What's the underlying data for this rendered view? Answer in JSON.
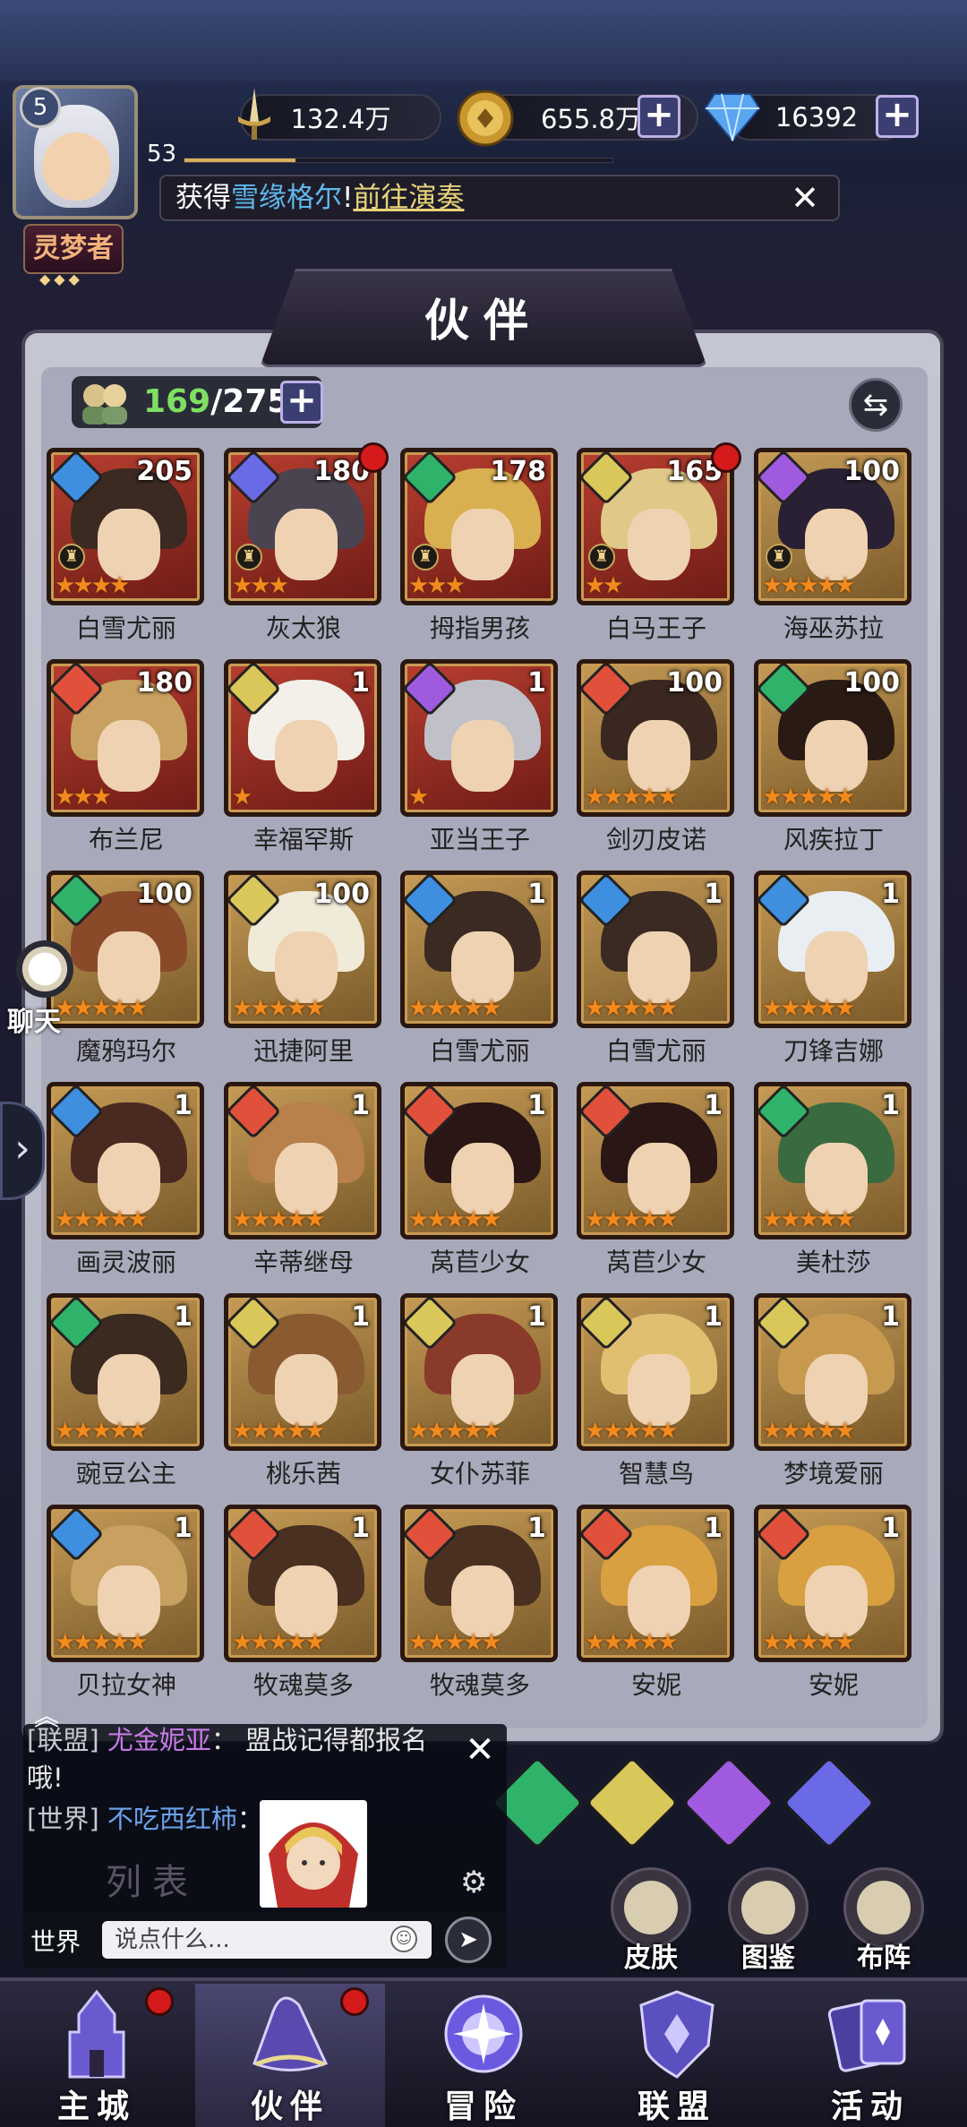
{
  "player": {
    "vip_level": "5",
    "level": "53",
    "xp_progress": 0.26,
    "rank": "灵梦者"
  },
  "resources": {
    "power": "132.4万",
    "gold": "655.8万",
    "diamonds": "16392"
  },
  "notice": {
    "prefix": "获得",
    "item": "雪缘格尔",
    "sep": "!",
    "link": "前往演奏"
  },
  "page_title": "伙伴",
  "roster_count": {
    "current": "169",
    "max": "/275"
  },
  "heroes": [
    {
      "name": "白雪尤丽",
      "level": "205",
      "element": "water",
      "stars": 4,
      "frame": "red",
      "badge": true,
      "red_dot": false
    },
    {
      "name": "灰太狼",
      "level": "180",
      "element": "void",
      "stars": 3,
      "frame": "red",
      "badge": true,
      "red_dot": true
    },
    {
      "name": "拇指男孩",
      "level": "178",
      "element": "wind",
      "stars": 3,
      "frame": "red",
      "badge": true,
      "red_dot": false
    },
    {
      "name": "白马王子",
      "level": "165",
      "element": "light",
      "stars": 2,
      "frame": "red",
      "badge": true,
      "red_dot": true
    },
    {
      "name": "海巫苏拉",
      "level": "100",
      "element": "dark",
      "stars": 5,
      "frame": "gold",
      "badge": true,
      "red_dot": false
    },
    {
      "name": "布兰尼",
      "level": "180",
      "element": "fire",
      "stars": 3,
      "frame": "red",
      "badge": false,
      "red_dot": false
    },
    {
      "name": "幸福罕斯",
      "level": "1",
      "element": "light",
      "stars": 1,
      "frame": "red",
      "badge": false,
      "red_dot": false
    },
    {
      "name": "亚当王子",
      "level": "1",
      "element": "dark",
      "stars": 1,
      "frame": "red",
      "badge": false,
      "red_dot": false
    },
    {
      "name": "剑刃皮诺",
      "level": "100",
      "element": "fire",
      "stars": 5,
      "frame": "gold",
      "badge": false,
      "red_dot": false
    },
    {
      "name": "风疾拉丁",
      "level": "100",
      "element": "wind",
      "stars": 5,
      "frame": "gold",
      "badge": false,
      "red_dot": false
    },
    {
      "name": "魔鸦玛尔",
      "level": "100",
      "element": "wind",
      "stars": 5,
      "frame": "gold",
      "badge": false,
      "red_dot": false
    },
    {
      "name": "迅捷阿里",
      "level": "100",
      "element": "light",
      "stars": 5,
      "frame": "gold",
      "badge": false,
      "red_dot": false
    },
    {
      "name": "白雪尤丽",
      "level": "1",
      "element": "water",
      "stars": 5,
      "frame": "gold",
      "badge": false,
      "red_dot": false
    },
    {
      "name": "白雪尤丽",
      "level": "1",
      "element": "water",
      "stars": 5,
      "frame": "gold",
      "badge": false,
      "red_dot": false
    },
    {
      "name": "刀锋吉娜",
      "level": "1",
      "element": "water",
      "stars": 5,
      "frame": "gold",
      "badge": false,
      "red_dot": false
    },
    {
      "name": "画灵波丽",
      "level": "1",
      "element": "water",
      "stars": 5,
      "frame": "gold",
      "badge": false,
      "red_dot": false
    },
    {
      "name": "辛蒂继母",
      "level": "1",
      "element": "fire",
      "stars": 5,
      "frame": "gold",
      "badge": false,
      "red_dot": false
    },
    {
      "name": "莴苣少女",
      "level": "1",
      "element": "fire",
      "stars": 5,
      "frame": "gold",
      "badge": false,
      "red_dot": false
    },
    {
      "name": "莴苣少女",
      "level": "1",
      "element": "fire",
      "stars": 5,
      "frame": "gold",
      "badge": false,
      "red_dot": false
    },
    {
      "name": "美杜莎",
      "level": "1",
      "element": "wind",
      "stars": 5,
      "frame": "gold",
      "badge": false,
      "red_dot": false
    },
    {
      "name": "豌豆公主",
      "level": "1",
      "element": "wind",
      "stars": 5,
      "frame": "gold",
      "badge": false,
      "red_dot": false
    },
    {
      "name": "桃乐茜",
      "level": "1",
      "element": "light",
      "stars": 5,
      "frame": "gold",
      "badge": false,
      "red_dot": false
    },
    {
      "name": "女仆苏菲",
      "level": "1",
      "element": "light",
      "stars": 5,
      "frame": "gold",
      "badge": false,
      "red_dot": false
    },
    {
      "name": "智慧鸟",
      "level": "1",
      "element": "light",
      "stars": 5,
      "frame": "gold",
      "badge": false,
      "red_dot": false
    },
    {
      "name": "梦境爱丽",
      "level": "1",
      "element": "light",
      "stars": 5,
      "frame": "gold",
      "badge": false,
      "red_dot": false
    },
    {
      "name": "贝拉女神",
      "level": "1",
      "element": "water",
      "stars": 5,
      "frame": "gold",
      "badge": false,
      "red_dot": false
    },
    {
      "name": "牧魂莫多",
      "level": "1",
      "element": "fire",
      "stars": 5,
      "frame": "gold",
      "badge": false,
      "red_dot": false
    },
    {
      "name": "牧魂莫多",
      "level": "1",
      "element": "fire",
      "stars": 5,
      "frame": "gold",
      "badge": false,
      "red_dot": false
    },
    {
      "name": "安妮",
      "level": "1",
      "element": "fire",
      "stars": 5,
      "frame": "gold",
      "badge": false,
      "red_dot": false
    },
    {
      "name": "安妮",
      "level": "1",
      "element": "fire",
      "stars": 5,
      "frame": "gold",
      "badge": false,
      "red_dot": false
    }
  ],
  "element_colors": {
    "water": "#3f8fe0",
    "void": "#6a6ae6",
    "wind": "#2fb36a",
    "light": "#d9c75a",
    "dark": "#a05ae0",
    "fire": "#e0503a"
  },
  "element_filters": [
    "wind",
    "light",
    "dark",
    "void"
  ],
  "chat": {
    "line1_tag": "[联盟]",
    "line1_name": "尤金妮亚",
    "line1_msg": "：  盟战记得都报名哦!",
    "line2_tag": "[世界]",
    "line2_name": "不吃西红柿",
    "line2_msg": "：",
    "channel": "世界",
    "input_placeholder": "说点什么...",
    "list_label": "列表"
  },
  "side": {
    "chat_label": "聊天"
  },
  "quick_buttons": {
    "skin": "皮肤",
    "gallery": "图鉴",
    "formation": "布阵"
  },
  "nav": {
    "main_city": "主城",
    "partners": "伙伴",
    "adventure": "冒险",
    "alliance": "联盟",
    "events": "活动"
  }
}
